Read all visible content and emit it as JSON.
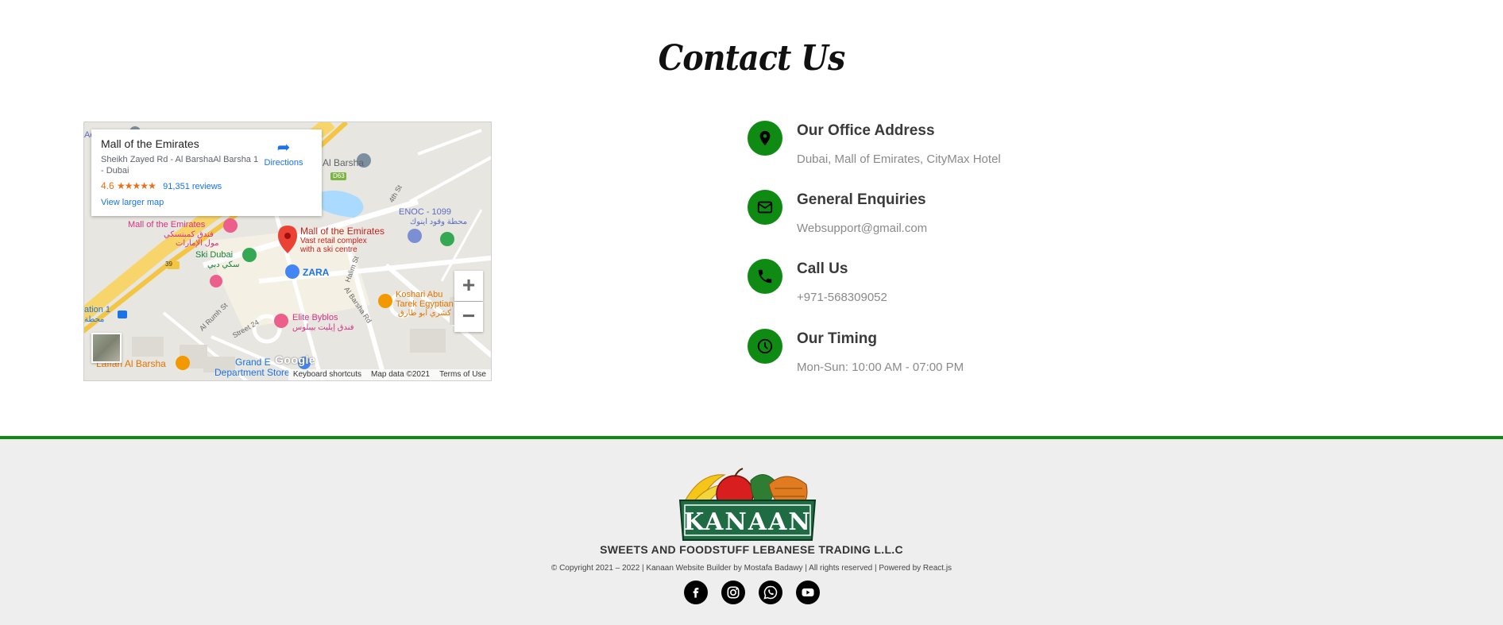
{
  "contact": {
    "title": "Contact Us"
  },
  "map": {
    "place_name": "Mall of the Emirates",
    "address": "Sheikh Zayed Rd - Al BarshaAl Barsha 1 - Dubai",
    "rating": "4.6",
    "stars": "★★★★★",
    "reviews": "91,351 reviews",
    "view_larger": "View larger map",
    "directions": "Directions",
    "zoom_in": "+",
    "zoom_out": "−",
    "google_logo": "Google",
    "footer": {
      "keyboard": "Keyboard shortcuts",
      "map_data": "Map data ©2021",
      "terms": "Terms of Use"
    },
    "labels": {
      "mall_marker": "Mall of the Emirates",
      "mall_desc_1": "Vast retail complex",
      "mall_desc_2": "with a ski centre",
      "mall_hotel": "Mall of the Emirates",
      "mall_hotel_ar1": "فندق كمبنسكي",
      "mall_hotel_ar2": "مول الإمارات",
      "ski_dubai": "Ski Dubai",
      "ski_dubai_ar": "سكي دبي",
      "zara": "ZARA",
      "enoc": "ENOC - 1099",
      "enoc_ar": "محطة وقود اينوك",
      "koshari_1": "Koshari Abu",
      "koshari_2": "Tarek Egyptian",
      "koshari_ar": "كشري ابو طارق",
      "elite_byblos": "Elite Byblos",
      "elite_byblos_ar": "فندق إيليت بيبلوس",
      "grand_1": "Grand E",
      "grand_2": "Department Store",
      "laffan": "Laffan Al Barsha",
      "al_barsha": "Al Barsha",
      "road_39": "39",
      "road_d63": "D63",
      "station": "ation 1",
      "station_ar": "محطة",
      "halim_st": "Halim St",
      "al_barsha_rd": "Al Barsha Rd",
      "street_24": "Street 24",
      "al_rumh": "Al Rumh St",
      "fourth_st": "4th St",
      "ac": "Ac"
    }
  },
  "contact_items": [
    {
      "icon": "location-pin-icon",
      "title": "Our Office Address",
      "value": "Dubai, Mall of Emirates, CityMax Hotel"
    },
    {
      "icon": "envelope-icon",
      "title": "General Enquiries",
      "value": "Websupport@gmail.com"
    },
    {
      "icon": "phone-icon",
      "title": "Call Us",
      "value": "+971-568309052"
    },
    {
      "icon": "clock-icon",
      "title": "Our Timing",
      "value": "Mon-Sun: 10:00 AM - 07:00 PM"
    }
  ],
  "footer": {
    "logo_text": "KANAAN",
    "company": "SWEETS AND FOODSTUFF LEBANESE TRADING L.L.C",
    "copyright": "© Copyright 2021 – 2022 | Kanaan Website Builder by Mostafa Badawy | All rights reserved | Powered by React.js",
    "socials": [
      "facebook-icon",
      "instagram-icon",
      "whatsapp-icon",
      "youtube-icon"
    ]
  },
  "colors": {
    "accent": "#0f8a13",
    "footer_bg": "#eeeeee",
    "text_dark": "#3a3a3a",
    "text_muted": "#8a8a8a",
    "link": "#1a73e8"
  }
}
